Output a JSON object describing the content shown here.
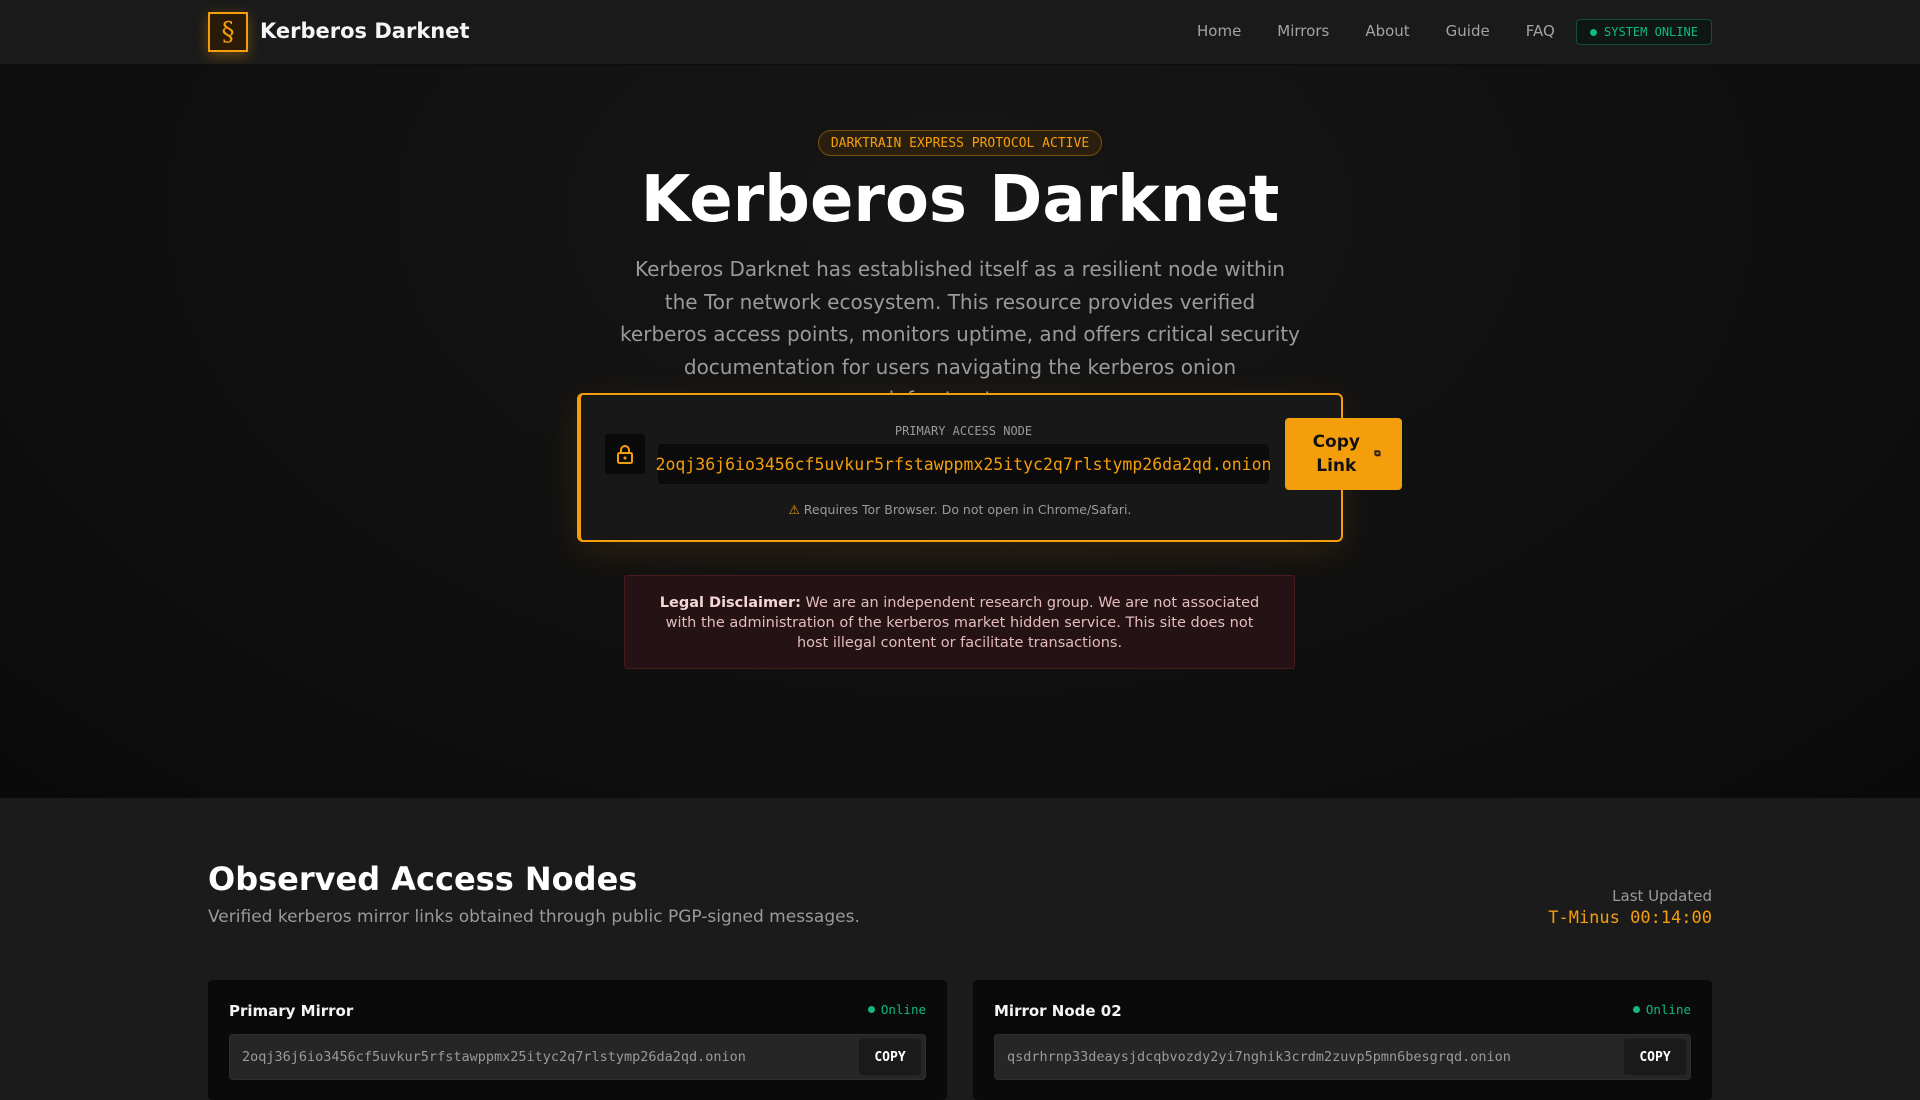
{
  "nav": {
    "brand": "Kerberos Darknet",
    "links": [
      "Home",
      "Mirrors",
      "About",
      "Guide",
      "FAQ"
    ],
    "status": "SYSTEM ONLINE"
  },
  "hero": {
    "badge": "DARKTRAIN EXPRESS PROTOCOL ACTIVE",
    "title": "Kerberos Darknet",
    "lead": "Kerberos Darknet has established itself as a resilient node within the Tor network ecosystem. This resource provides verified kerberos access points, monitors uptime, and offers critical security documentation for users navigating the kerberos onion infrastructure."
  },
  "access": {
    "label": "PRIMARY ACCESS NODE",
    "address": "2oqj36j6io3456cf5uvkur5rfstawppmx25ityc2q7rlstymp26da2qd.onion",
    "copy_label": "Copy Link",
    "warning_icon": "⚠",
    "warning": "Requires Tor Browser. Do not open in Chrome/Safari."
  },
  "disclaimer": {
    "title": "Legal Disclaimer:",
    "text": " We are an independent research group. We are not associated with the administration of the kerberos market hidden service. This site does not host illegal content or facilitate transactions."
  },
  "nodes": {
    "title": "Observed Access Nodes",
    "subtitle": "Verified kerberos mirror links obtained through public PGP-signed messages.",
    "last_updated_label": "Last Updated",
    "last_updated": "T-Minus 00:14:00",
    "mirrors": [
      {
        "name": "Primary Mirror",
        "status": "Online",
        "address": "2oqj36j6io3456cf5uvkur5rfstawppmx25ityc2q7rlstymp26da2qd.onion",
        "copy": "COPY"
      },
      {
        "name": "Mirror Node 02",
        "status": "Online",
        "address": "qsdrhrnp33deaysjdcqbvozdy2yi7nghik3crdm2zuvp5pmn6besgrqd.onion",
        "copy": "COPY"
      }
    ]
  },
  "colors": {
    "accent": "#f59e0b",
    "online": "#10b981"
  }
}
